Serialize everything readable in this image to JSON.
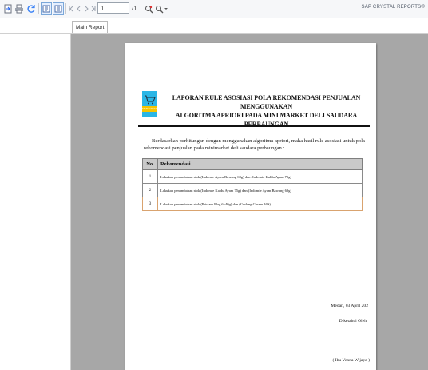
{
  "toolbar": {
    "icons": [
      "export-icon",
      "print-icon",
      "refresh-icon",
      "toggle-group-tree-icon",
      "toggle-parameter-panel-icon",
      "first-page-icon",
      "previous-page-icon",
      "next-page-icon",
      "last-page-icon",
      "search-icon",
      "zoom-icon"
    ],
    "page_input_value": "1",
    "page_count_text": "/1",
    "brand": "SAP CRYSTAL REPORTS®"
  },
  "tabs": [
    {
      "label": "Main Report"
    }
  ],
  "report": {
    "logo_text": "MINIMARKET",
    "title_line1": "LAPORAN RULE ASOSIASI POLA REKOMENDASI PENJUALAN MENGGUNAKAN",
    "title_line2": "ALGORITMA APRIORI PADA MINI MARKET DELI SAUDARA PERBAUNGAN",
    "intro": "Berdasarkan perhitungan dengan menggunakan algoritma apriori, maka hasil rule asosiasi untuk pola rekomendasi penjualan pada minimarket deli saudara perbaungan :",
    "table": {
      "headers": [
        "No.",
        "Rekomendasi"
      ],
      "rows": [
        {
          "no": "1",
          "text": "Lakukan penambahan stok (Indomie Ayam Bawang 69g) dan (Indomie Kaldu Ayam 75g)"
        },
        {
          "no": "2",
          "text": "Lakukan penambahan stok (Indomie Kaldu Ayam 75g) dan (Indomie Ayam Bawang 69g)"
        },
        {
          "no": "3",
          "text": "Lakukan penambahan stok (Pristam Flag 6x40g) dan (Gudang Garam 16S)"
        }
      ]
    },
    "place_date": "Medan, 03 April 202",
    "acknowledged": "Diketahui Oleh",
    "signatory": "( Ibu Venna Wijaya )"
  }
}
